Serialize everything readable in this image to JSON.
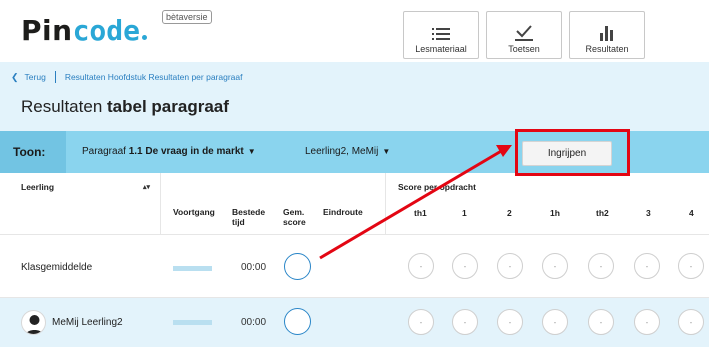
{
  "logo": {
    "part1": "Pin",
    "part2": "code",
    "beta": "bètaversie"
  },
  "topnav": [
    {
      "label": "Lesmateriaal",
      "icon": "list-icon"
    },
    {
      "label": "Toetsen",
      "icon": "check-icon"
    },
    {
      "label": "Resultaten",
      "icon": "bar-chart-icon"
    }
  ],
  "breadcrumb": {
    "back": "Terug",
    "path": "Resultaten Hoofdstuk Resultaten per paragraaf"
  },
  "title": {
    "light": "Resultaten",
    "bold": "tabel paragraaf"
  },
  "toon": {
    "label": "Toon:",
    "paragraph_prefix": "Paragraaf",
    "paragraph_bold": "1.1 De vraag in de markt",
    "students": "Leerling2, MeMij",
    "action_button": "Ingrijpen"
  },
  "table": {
    "col_student": "Leerling",
    "progress_headers": [
      "Voortgang",
      "Bestede tijd",
      "Gem. score",
      "Eindroute"
    ],
    "score_group": "Score per opdracht",
    "score_cols": [
      "th1",
      "1",
      "2",
      "1h",
      "th2",
      "3",
      "4"
    ],
    "rows": [
      {
        "name": "Klasgemiddelde",
        "time": "00:00",
        "scores": [
          "-",
          "-",
          "-",
          "-",
          "-",
          "-",
          "-"
        ]
      },
      {
        "name": "MeMij Leerling2",
        "time": "00:00",
        "scores": [
          "-",
          "-",
          "-",
          "-",
          "-",
          "-",
          "-"
        ]
      }
    ]
  },
  "colors": {
    "accent": "#2aa7d6",
    "toonbar": "#8ad4ee",
    "panel": "#e3f3fb",
    "highlight": "#e30613"
  }
}
